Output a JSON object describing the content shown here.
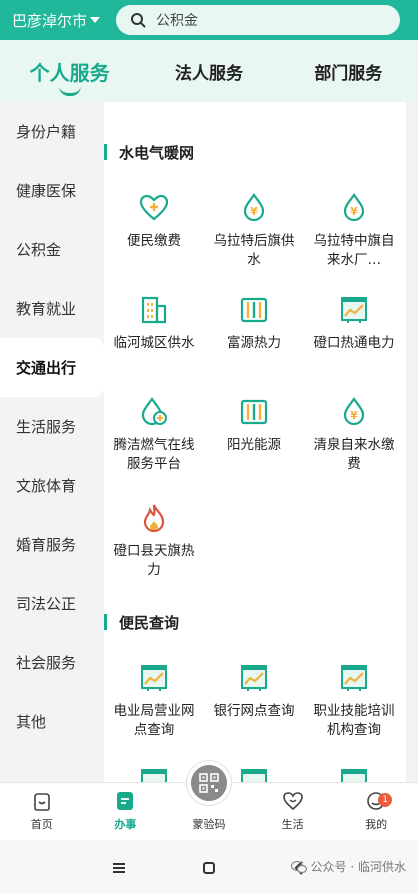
{
  "header": {
    "city": "巴彦淖尔市",
    "search_placeholder": "公积金"
  },
  "top_tabs": [
    {
      "label": "个人服务",
      "active": true
    },
    {
      "label": "法人服务",
      "active": false
    },
    {
      "label": "部门服务",
      "active": false
    }
  ],
  "sidebar": {
    "items": [
      {
        "label": "身份户籍"
      },
      {
        "label": "健康医保"
      },
      {
        "label": "公积金"
      },
      {
        "label": "教育就业"
      },
      {
        "label": "交通出行",
        "active": true
      },
      {
        "label": "生活服务"
      },
      {
        "label": "文旅体育"
      },
      {
        "label": "婚育服务"
      },
      {
        "label": "司法公正"
      },
      {
        "label": "社会服务"
      },
      {
        "label": "其他"
      }
    ]
  },
  "sections": [
    {
      "title": "水电气暖网",
      "items": [
        {
          "label": "便民缴费",
          "icon": "heart-plus-icon"
        },
        {
          "label": "乌拉特后旗供水",
          "icon": "water-drop-yen-icon"
        },
        {
          "label": "乌拉特中旗自来水厂…",
          "icon": "water-drop-yen-icon"
        },
        {
          "label": "临河城区供水",
          "icon": "building-icon"
        },
        {
          "label": "富源热力",
          "icon": "radiator-icon"
        },
        {
          "label": "磴口热通电力",
          "icon": "chart-board-icon"
        },
        {
          "label": "腾洁燃气在线服务平台",
          "icon": "drop-plus-icon"
        },
        {
          "label": "阳光能源",
          "icon": "radiator-icon"
        },
        {
          "label": "清泉自来水缴费",
          "icon": "water-drop-yen-icon"
        },
        {
          "label": "磴口县天旗热力",
          "icon": "flame-icon"
        }
      ]
    },
    {
      "title": "便民查询",
      "items": [
        {
          "label": "电业局营业网点查询",
          "icon": "chart-board-icon"
        },
        {
          "label": "银行网点查询",
          "icon": "chart-board-icon"
        },
        {
          "label": "职业技能培训机构查询",
          "icon": "chart-board-icon"
        }
      ]
    }
  ],
  "bottom_nav": [
    {
      "label": "首页",
      "icon": "home-icon"
    },
    {
      "label": "办事",
      "icon": "service-icon",
      "active": true
    },
    {
      "label": "蒙验码",
      "icon": "qr-code-icon"
    },
    {
      "label": "生活",
      "icon": "heart-icon"
    },
    {
      "label": "我的",
      "icon": "profile-icon",
      "badge": "1"
    }
  ],
  "watermark": "公众号 · 临河供水",
  "colors": {
    "brand": "#20b79a",
    "accent": "#19a98d",
    "icon_orange": "#f0b23a",
    "icon_red": "#d9553b"
  }
}
